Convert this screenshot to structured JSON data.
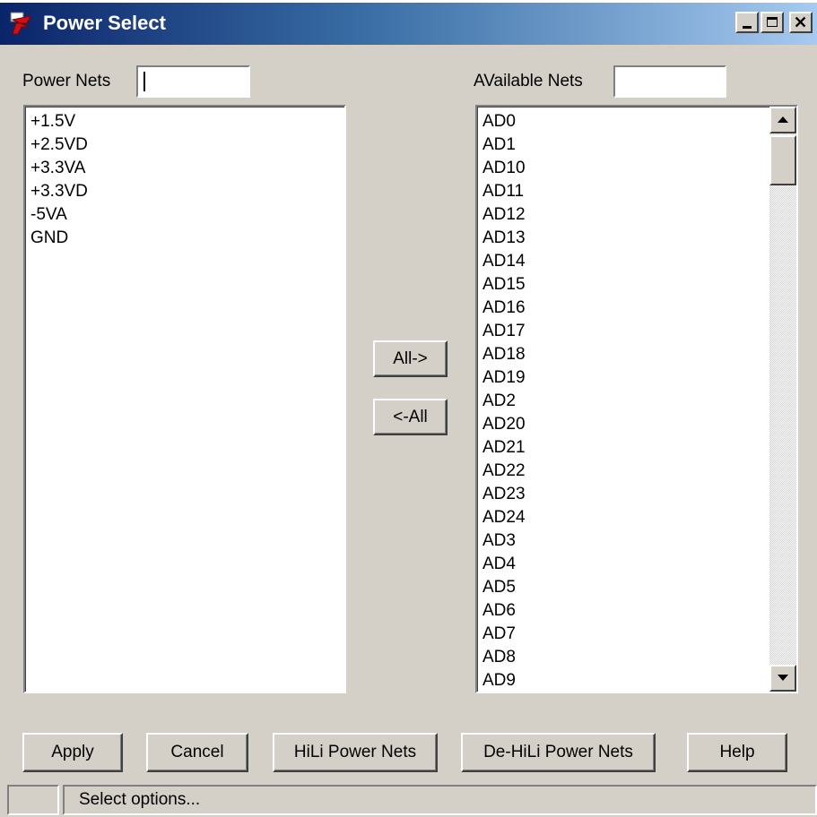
{
  "window": {
    "title": "Power Select",
    "title_gradient_start": "#0a246a",
    "title_gradient_end": "#a6caf0",
    "icon": "app-logo-icon",
    "controls": {
      "minimize_icon": "minimize-icon",
      "maximize_icon": "maximize-icon",
      "close_icon": "close-icon"
    }
  },
  "power_nets": {
    "label": "Power Nets",
    "filter_value": "",
    "items": [
      "+1.5V",
      "+2.5VD",
      "+3.3VA",
      "+3.3VD",
      "-5VA",
      "GND"
    ]
  },
  "available_nets": {
    "label": "AVailable Nets",
    "filter_value": "",
    "items": [
      "AD0",
      "AD1",
      "AD10",
      "AD11",
      "AD12",
      "AD13",
      "AD14",
      "AD15",
      "AD16",
      "AD17",
      "AD18",
      "AD19",
      "AD2",
      "AD20",
      "AD21",
      "AD22",
      "AD23",
      "AD24",
      "AD3",
      "AD4",
      "AD5",
      "AD6",
      "AD7",
      "AD8",
      "AD9"
    ]
  },
  "transfer": {
    "all_right_label": "All->",
    "all_left_label": "<-All"
  },
  "buttons": {
    "apply": "Apply",
    "cancel": "Cancel",
    "hili": "HiLi Power Nets",
    "dehili": "De-HiLi Power Nets",
    "help": "Help"
  },
  "status": {
    "text": "Select options..."
  },
  "colors": {
    "dialog_bg": "#d4d0c8",
    "list_bg": "#ffffff"
  }
}
